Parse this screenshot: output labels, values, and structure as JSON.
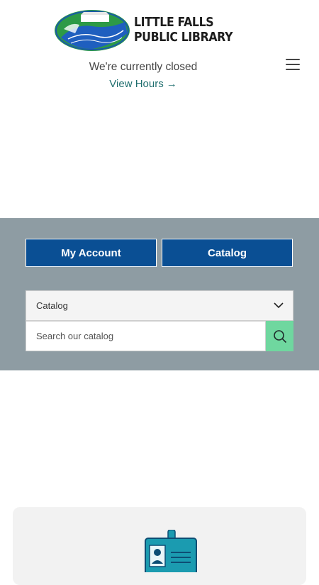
{
  "header": {
    "logo_line1": "LITTLE FALLS",
    "logo_line2": "PUBLIC LIBRARY",
    "status_text": "We're currently closed",
    "hours_link": "View Hours",
    "hours_arrow": "→",
    "menu_icon": "hamburger-menu-icon"
  },
  "quick_links": {
    "my_account_label": "My Account",
    "catalog_label": "Catalog"
  },
  "search": {
    "scope_selected": "Catalog",
    "placeholder": "Search our catalog",
    "search_icon": "search-icon"
  },
  "card": {
    "icon": "library-card-icon"
  },
  "colors": {
    "band_bg": "#8e9ca3",
    "button_blue": "#0a4f94",
    "search_green": "#6fd79f",
    "link_teal": "#1f6e6e"
  }
}
